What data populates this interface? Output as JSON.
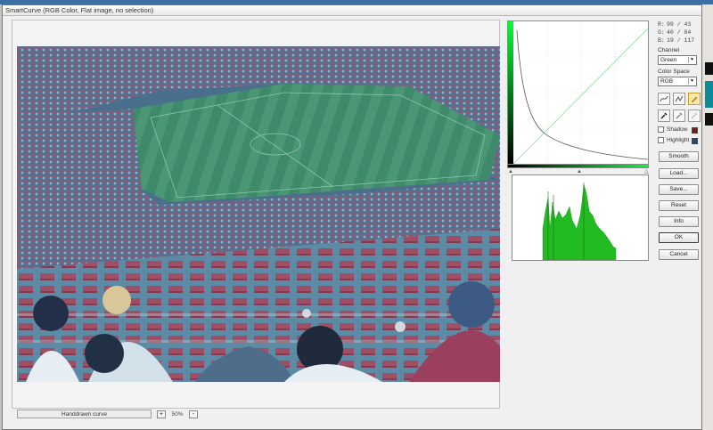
{
  "dialog": {
    "title": "SmartCurve (RGB Color, Flat image, no selection)"
  },
  "status": {
    "mode_label": "Handdrawn curve",
    "zoom_minus": "-",
    "zoom_value": "50%",
    "zoom_plus": "+"
  },
  "readout": {
    "r_key": "R:",
    "r_val": "99 / 43",
    "g_key": "G:",
    "g_val": "40 / 84",
    "b_key": "B:",
    "b_val": "19 / 117"
  },
  "controls": {
    "channel_label": "Channel",
    "channel_value": "Green",
    "colorspace_label": "Color Space",
    "colorspace_value": "RGB",
    "shadow_label": "Shadow",
    "highlight_label": "Highlight",
    "shadow_color": "#7a1a10",
    "highlight_color": "#1e4a86",
    "tools": [
      "smooth-curve-icon",
      "sharp-curve-icon",
      "pencil-icon",
      "black-eyedropper-icon",
      "gray-eyedropper-icon",
      "white-eyedropper-icon"
    ]
  },
  "buttons": {
    "smooth": "Smooth",
    "load": "Load...",
    "save": "Save...",
    "reset": "Reset",
    "info": "Info",
    "ok": "OK",
    "cancel": "Cancel"
  },
  "colors": {
    "curve_green": "#33dd55",
    "histogram_green": "#22bb22",
    "accent_green": "#00ff33"
  }
}
